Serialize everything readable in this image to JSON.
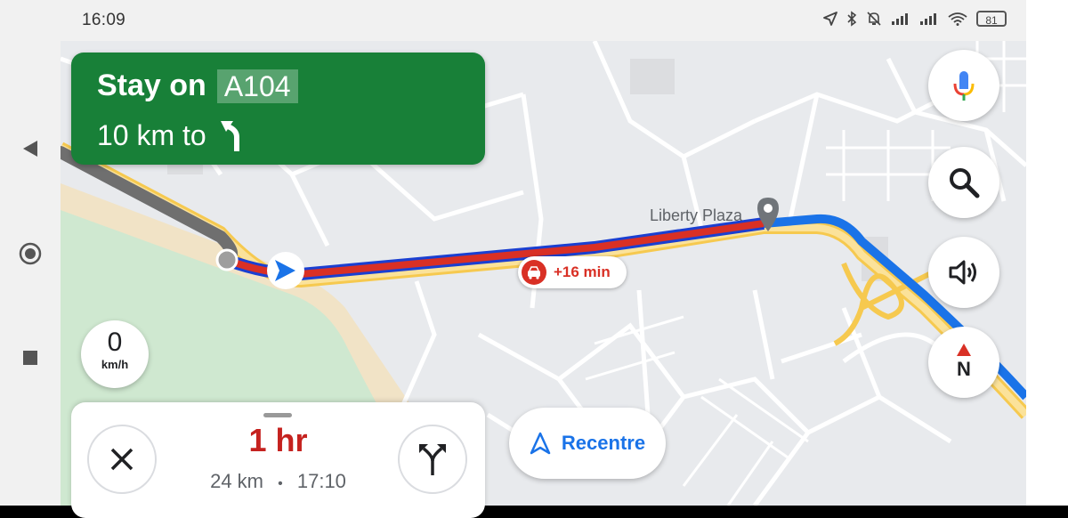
{
  "status_bar": {
    "time": "16:09",
    "battery": "81",
    "icons": [
      "location-arrow-icon",
      "bluetooth-icon",
      "mute-icon",
      "signal-icon",
      "signal-icon",
      "wifi-icon",
      "battery-icon"
    ]
  },
  "system_nav": {
    "back": "back-triangle-icon",
    "home": "home-circle-icon",
    "recents": "recents-square-icon"
  },
  "instruction": {
    "line1_prefix": "Stay on",
    "road": "A104",
    "line2_prefix": "10 km to",
    "turn_icon": "keep-left-arrow-icon"
  },
  "speed": {
    "value": "0",
    "unit": "km/h"
  },
  "map": {
    "place_label": "Liberty Plaza",
    "traffic_delay": "+16 min"
  },
  "trip": {
    "duration": "1 hr",
    "distance": "24 km",
    "separator": "•",
    "arrival": "17:10"
  },
  "controls": {
    "recentre_label": "Recentre",
    "compass_letter": "N"
  },
  "colors": {
    "banner": "#188038",
    "route_blue": "#1a73e8",
    "traffic_red": "#d93025",
    "eta_red": "#c5221f"
  }
}
